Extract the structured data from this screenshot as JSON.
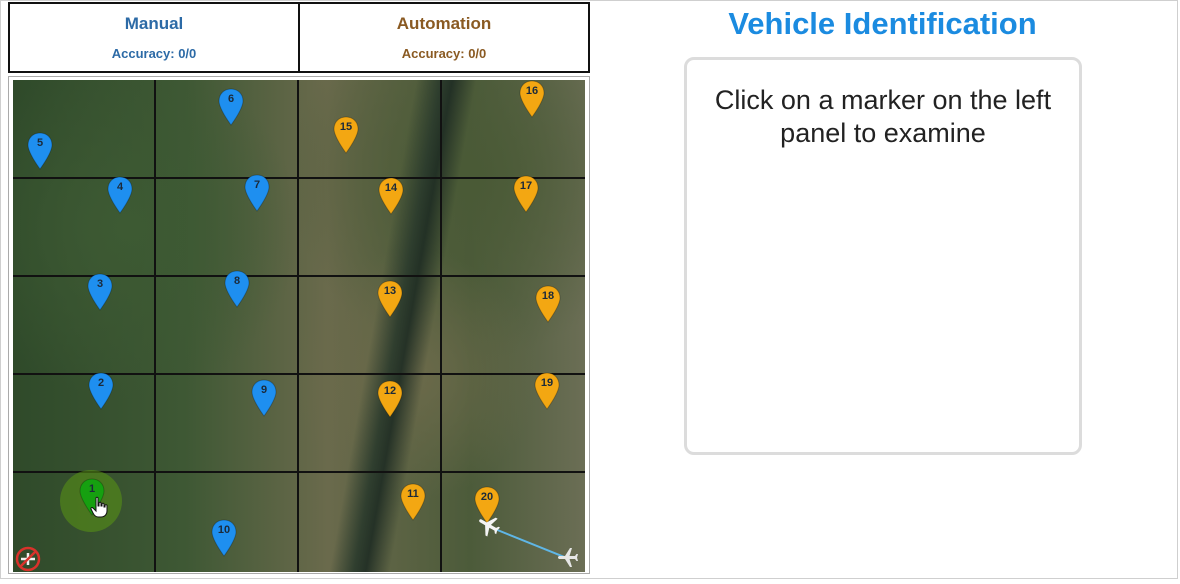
{
  "tabs": {
    "manual": {
      "label": "Manual",
      "accuracy": "Accuracy: 0/0"
    },
    "automation": {
      "label": "Automation",
      "accuracy": "Accuracy: 0/0"
    }
  },
  "right_panel": {
    "title": "Vehicle Identification",
    "message": "Click on a marker on the left panel to examine"
  },
  "colors": {
    "manual_marker": "#1e8ff0",
    "auto_marker": "#f3a712",
    "selected_marker": "#16a010",
    "title_blue": "#1b8be0"
  },
  "markers": [
    {
      "id": "1",
      "type": "selected",
      "color": "#16a010"
    },
    {
      "id": "2",
      "type": "manual",
      "color": "#1e8ff0"
    },
    {
      "id": "3",
      "type": "manual",
      "color": "#1e8ff0"
    },
    {
      "id": "4",
      "type": "manual",
      "color": "#1e8ff0"
    },
    {
      "id": "5",
      "type": "manual",
      "color": "#1e8ff0"
    },
    {
      "id": "6",
      "type": "manual",
      "color": "#1e8ff0"
    },
    {
      "id": "7",
      "type": "manual",
      "color": "#1e8ff0"
    },
    {
      "id": "8",
      "type": "manual",
      "color": "#1e8ff0"
    },
    {
      "id": "9",
      "type": "manual",
      "color": "#1e8ff0"
    },
    {
      "id": "10",
      "type": "manual",
      "color": "#1e8ff0"
    },
    {
      "id": "11",
      "type": "automation",
      "color": "#f3a712"
    },
    {
      "id": "12",
      "type": "automation",
      "color": "#f3a712"
    },
    {
      "id": "13",
      "type": "automation",
      "color": "#f3a712"
    },
    {
      "id": "14",
      "type": "automation",
      "color": "#f3a712"
    },
    {
      "id": "15",
      "type": "automation",
      "color": "#f3a712"
    },
    {
      "id": "16",
      "type": "automation",
      "color": "#f3a712"
    },
    {
      "id": "17",
      "type": "automation",
      "color": "#f3a712"
    },
    {
      "id": "18",
      "type": "automation",
      "color": "#f3a712"
    },
    {
      "id": "19",
      "type": "automation",
      "color": "#f3a712"
    },
    {
      "id": "20",
      "type": "automation",
      "color": "#f3a712"
    }
  ],
  "icons": {
    "marker": "map-pin-icon",
    "aircraft": "airplane-icon",
    "no_aircraft": "no-airplane-icon",
    "cursor": "hand-pointer-icon"
  }
}
